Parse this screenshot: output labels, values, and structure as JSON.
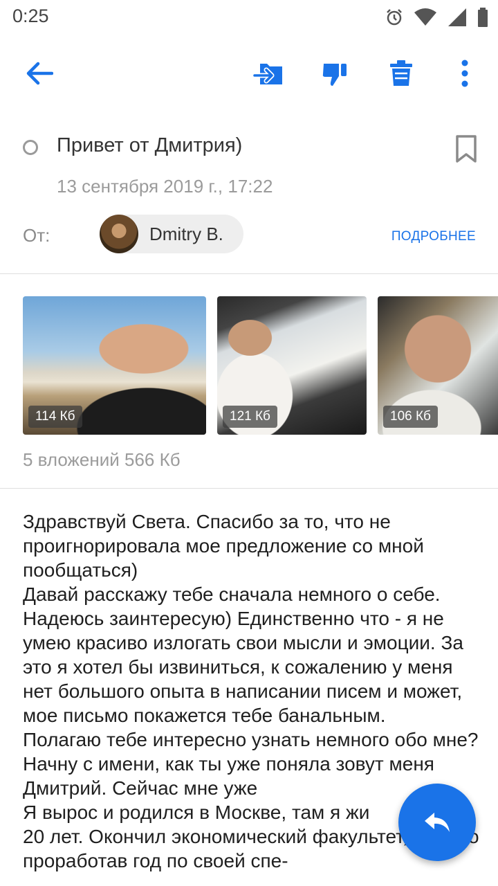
{
  "status_bar": {
    "time": "0:25",
    "icons": [
      "alarm-icon",
      "wifi-icon",
      "signal-icon",
      "battery-icon"
    ]
  },
  "toolbar": {
    "icons": [
      "back-arrow-icon",
      "move-to-folder-icon",
      "thumbs-down-icon",
      "trash-icon",
      "more-vert-icon"
    ],
    "accent_color": "#1a73e8"
  },
  "message": {
    "subject": "Привет от Дмитрия)",
    "date": "13 сентября 2019 г., 17:22",
    "from_label": "От:",
    "sender_name": "Dmitry B.",
    "details_label": "ПОДРОБНЕЕ"
  },
  "attachments": {
    "items": [
      {
        "size": "114  Кб"
      },
      {
        "size": "121  Кб"
      },
      {
        "size": "106  Кб"
      }
    ],
    "summary": "5 вложений 566  Кб"
  },
  "body": {
    "text": "Здравствуй Света. Спасибо за то, что не проигнорировала мое предложение со мной пообщаться)\nДавай расскажу тебе сначала немного о себе. Надеюсь заинтересую) Единственно что - я не умею красиво излогать свои мысли и эмоции. За это я хотел бы извиниться, к сожалению у меня нет большого опыта в написании писем и может, мое письмо покажется тебе банальным.\nПолагаю тебе интересно узнать немного обо мне? Начну с имени, как ты уже поняла зовут меня Дмитрий. Сейчас мне уже \nЯ вырос и родился в Москве, там я жи\n20 лет. Окончил экономический факультет, МГУ но проработав год по своей спе-"
  },
  "fab": {
    "icon": "reply-icon"
  }
}
